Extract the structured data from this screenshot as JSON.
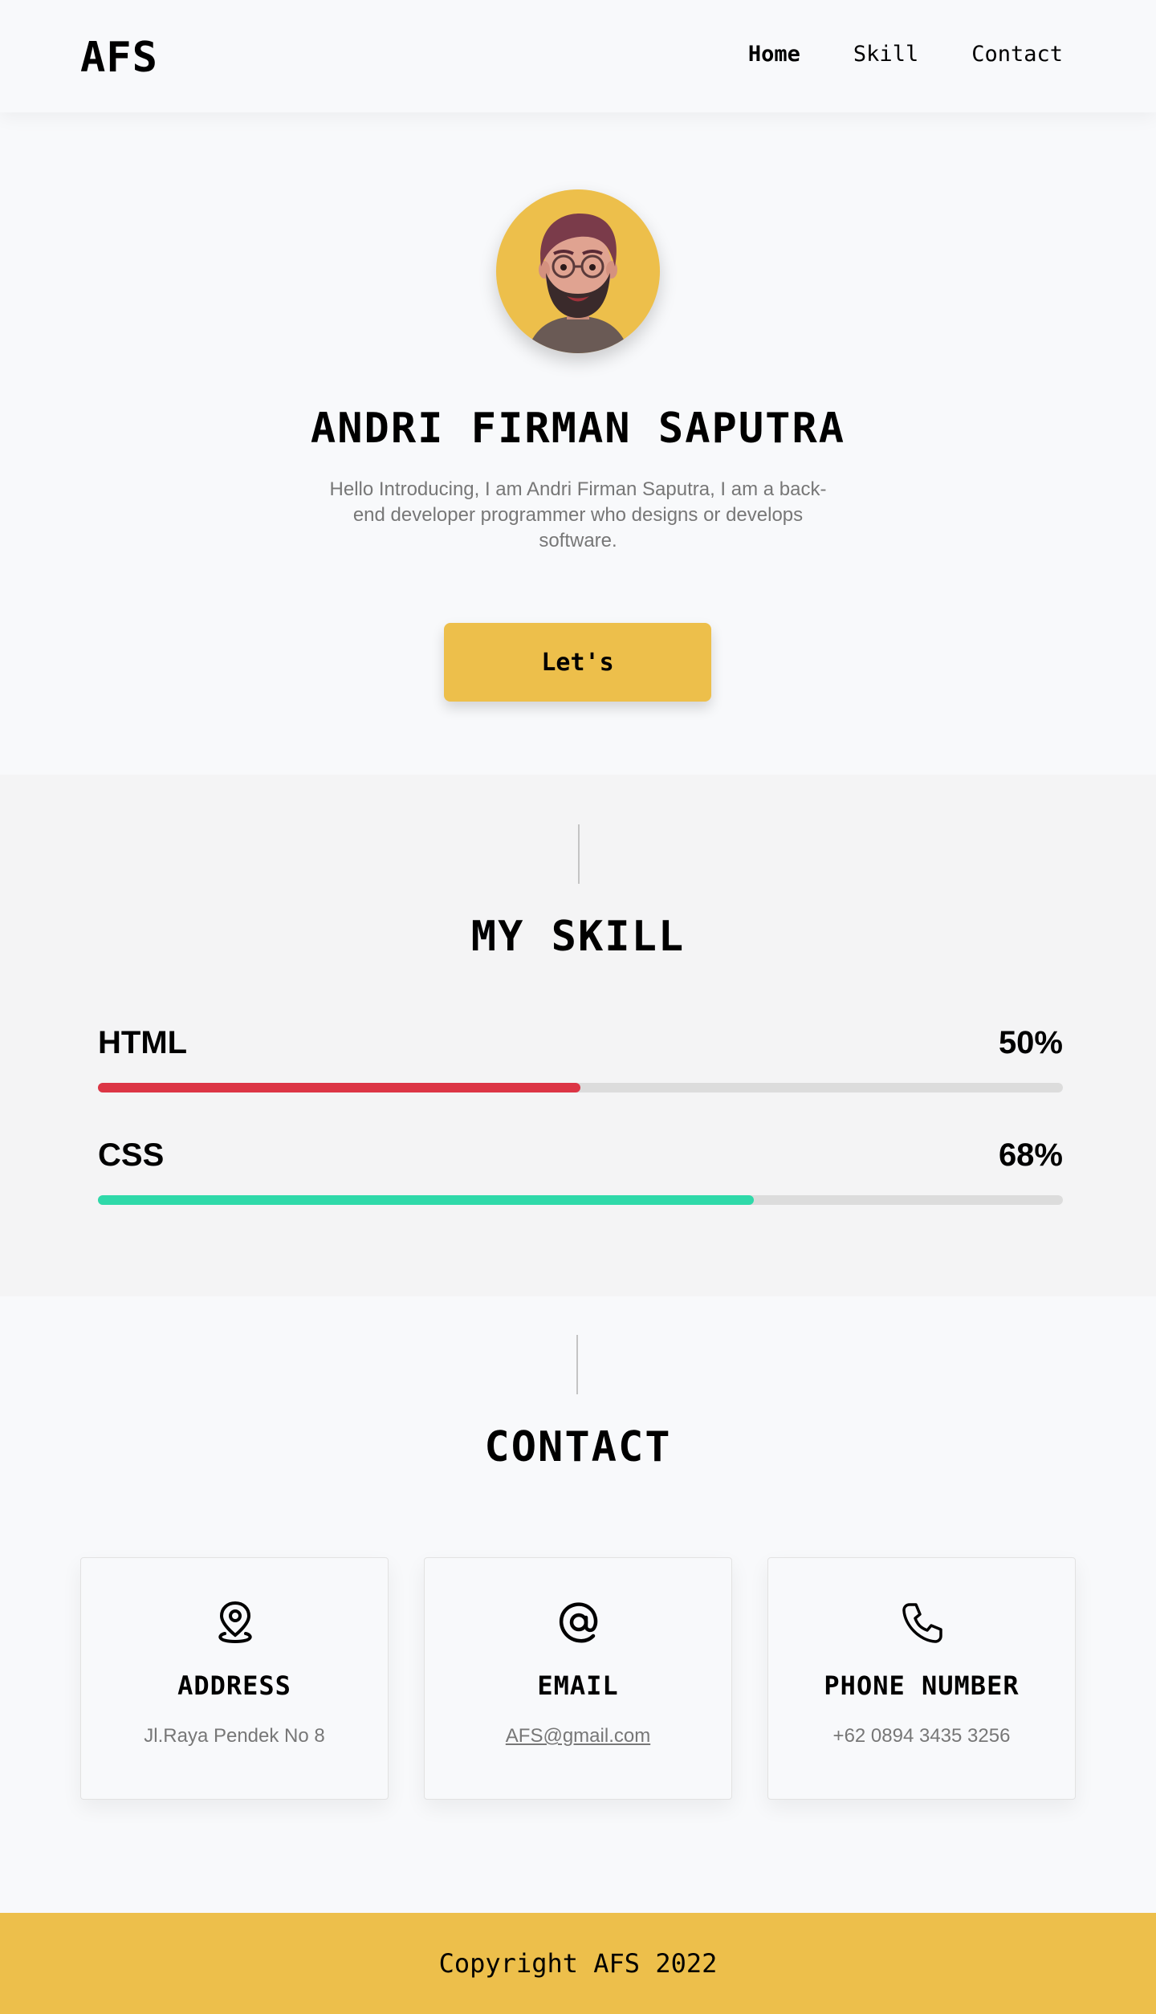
{
  "nav": {
    "brand": "AFS",
    "links": [
      {
        "label": "Home",
        "active": true
      },
      {
        "label": "Skill",
        "active": false
      },
      {
        "label": "Contact",
        "active": false
      }
    ]
  },
  "hero": {
    "avatar_icon": "memoji-avatar",
    "name": "ANDRI FIRMAN SAPUTRA",
    "intro": "Hello Introducing, I am Andri Firman Saputra, I am a back-end developer programmer who designs or develops software.",
    "button_label": "Let's"
  },
  "skill": {
    "title": "MY SKILL",
    "items": [
      {
        "name": "HTML",
        "percent_label": "50%",
        "value": 50,
        "color": "#dc3545"
      },
      {
        "name": "CSS",
        "percent_label": "68%",
        "value": 68,
        "color": "#2fd9a9"
      }
    ]
  },
  "contact": {
    "title": "CONTACT",
    "cards": [
      {
        "icon": "location-pin-icon",
        "title": "ADDRESS",
        "value": "Jl.Raya Pendek No 8"
      },
      {
        "icon": "at-sign-icon",
        "title": "EMAIL",
        "value": "AFS@gmail.com"
      },
      {
        "icon": "phone-icon",
        "title": "PHONE NUMBER",
        "value": "+62 0894 3435 3256"
      }
    ]
  },
  "footer": {
    "text": "Copyright AFS 2022"
  },
  "colors": {
    "accent": "#edbf4b",
    "background": "#f8f9fb",
    "section_alt": "#f4f4f5"
  }
}
